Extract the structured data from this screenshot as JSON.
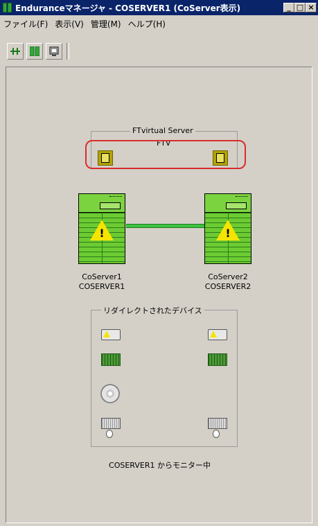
{
  "window": {
    "title": "Enduranceマネージャ - COSERVER1 (CoServer表示)"
  },
  "window_buttons": [
    "_",
    "□",
    "×"
  ],
  "menu": [
    "ファイル(F)",
    "表示(V)",
    "管理(M)",
    "ヘルプ(H)"
  ],
  "toolbar": {
    "icons": [
      "connect-icon",
      "servers-icon",
      "monitor-icon"
    ]
  },
  "ftvirtual": {
    "group_title": "FTvirtual Server",
    "label": "FTV"
  },
  "servers": [
    {
      "name": "CoServer1",
      "host": "COSERVER1"
    },
    {
      "name": "CoServer2",
      "host": "COSERVER2"
    }
  ],
  "devices": {
    "group_title": "リダイレクトされたデバイス"
  },
  "status": "COSERVER1 からモニター中",
  "colors": {
    "titlebar": "#0a246a",
    "server_green": "#6ccb32",
    "warning": "#f5e400",
    "ftv_highlight": "#d92b2b",
    "link": "#3cc23f"
  }
}
